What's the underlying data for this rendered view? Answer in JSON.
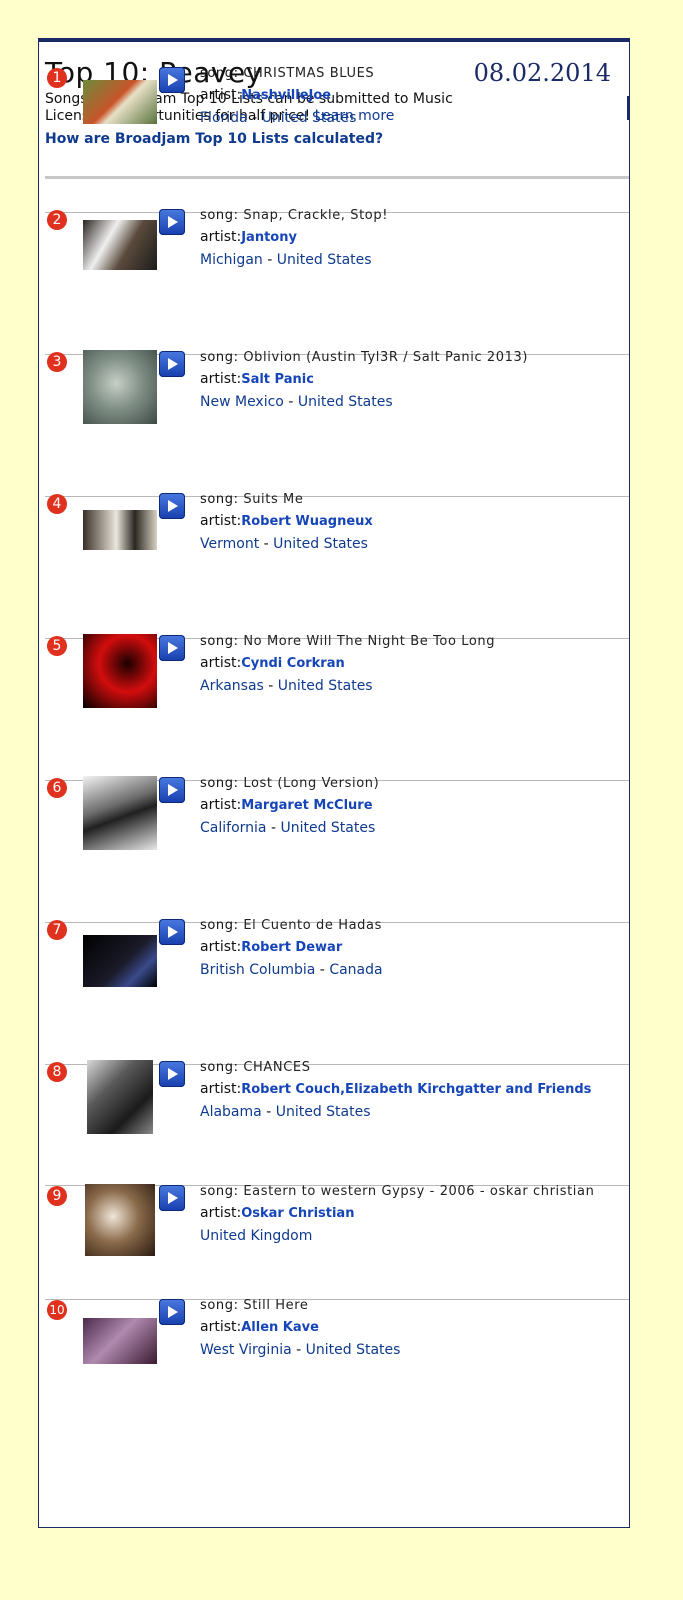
{
  "header": {
    "title": "Top 10: Peavey",
    "date": "08.02.2014",
    "description": "Songs in Broadjam Top 10 Lists can be submitted to Music Licensing Opportunities for half price!",
    "learn_more": "Learn more",
    "calc_link": "How are Broadjam Top 10 Lists calculated?"
  },
  "labels": {
    "song": "song:",
    "artist": "artist:",
    "separator": "-"
  },
  "entries": [
    {
      "rank": "1",
      "song": "CHRISTMAS BLUES",
      "artist": "NashvilleJoe",
      "region": "Florida",
      "country": "United States"
    },
    {
      "rank": "2",
      "song": "Snap, Crackle, Stop!",
      "artist": "Jantony",
      "region": "Michigan",
      "country": "United States"
    },
    {
      "rank": "3",
      "song": "Oblivion (Austin Tyl3R / Salt Panic 2013)",
      "artist": "Salt Panic",
      "region": "New Mexico",
      "country": "United States"
    },
    {
      "rank": "4",
      "song": "Suits Me",
      "artist": "Robert Wuagneux",
      "region": "Vermont",
      "country": "United States"
    },
    {
      "rank": "5",
      "song": "No More Will The Night Be Too Long",
      "artist": "Cyndi Corkran",
      "region": "Arkansas",
      "country": "United States"
    },
    {
      "rank": "6",
      "song": "Lost (Long Version)",
      "artist": "Margaret McClure",
      "region": "California",
      "country": "United States"
    },
    {
      "rank": "7",
      "song": "El Cuento de Hadas",
      "artist": "Robert Dewar",
      "region": "British Columbia",
      "country": "Canada"
    },
    {
      "rank": "8",
      "song": "CHANCES",
      "artist": "Robert Couch,Elizabeth Kirchgatter and Friends",
      "region": "Alabama",
      "country": "United States"
    },
    {
      "rank": "9",
      "song": "Eastern to western Gypsy - 2006 - oskar christian",
      "artist": "Oskar Christian",
      "region": "",
      "country": "United Kingdom"
    },
    {
      "rank": "10",
      "song": "Still Here",
      "artist": "Allen Kave",
      "region": "West Virginia",
      "country": "United States"
    }
  ],
  "colors": {
    "background": "#ffffcc",
    "border": "#1a2a66",
    "link": "#0f3a8e",
    "artist": "#1545b8",
    "rank_badge": "#e0301e",
    "play_button": "#2a56c8"
  }
}
